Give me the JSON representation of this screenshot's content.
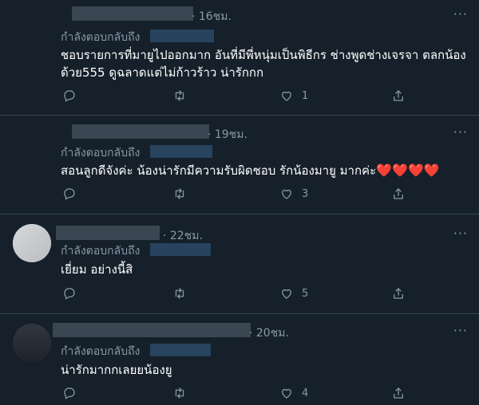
{
  "tweets": [
    {
      "time": "· 16ชม.",
      "replying": "กำลังตอบกลับถึง",
      "text_lines": [
        "ชอบรายการที่มายูไปออกมาก อันที่มีพี่หนุ่มเป็นพิธีกร ช่างพูดช่างเจรจา ตลกน้อง",
        "ด้วย555 ดูฉลาดแต่ไม่ก้าวร้าว น่ารักกก"
      ],
      "likes": "1",
      "retweets": "",
      "replies": ""
    },
    {
      "time": "· 19ชม.",
      "replying": "กำลังตอบกลับถึง",
      "text": "สอนลูกดีจังค่ะ น้องน่ารักมีความรับผิดชอบ รักน้องมายู มากค่ะ",
      "emojis": [
        "❤️",
        "❤️",
        "❤️",
        "❤️"
      ],
      "retweets": "",
      "likes": "3"
    },
    {
      "time": "· 22ชม.",
      "replying": "กำลังตอบกลับถึง",
      "text": "เยี่ยม อย่างนี้สิ",
      "likes": "5"
    },
    {
      "time": "· 20ชม.",
      "replying": "กำลังตอบกลับถึง",
      "text": "น่ารักมากกเลยยน้องยู",
      "likes": "4"
    }
  ],
  "more_symbol": "···",
  "colors": {
    "background": "#15202b",
    "muted": "#8899a6",
    "divider": "#38444d",
    "heart": "#e0245e"
  }
}
